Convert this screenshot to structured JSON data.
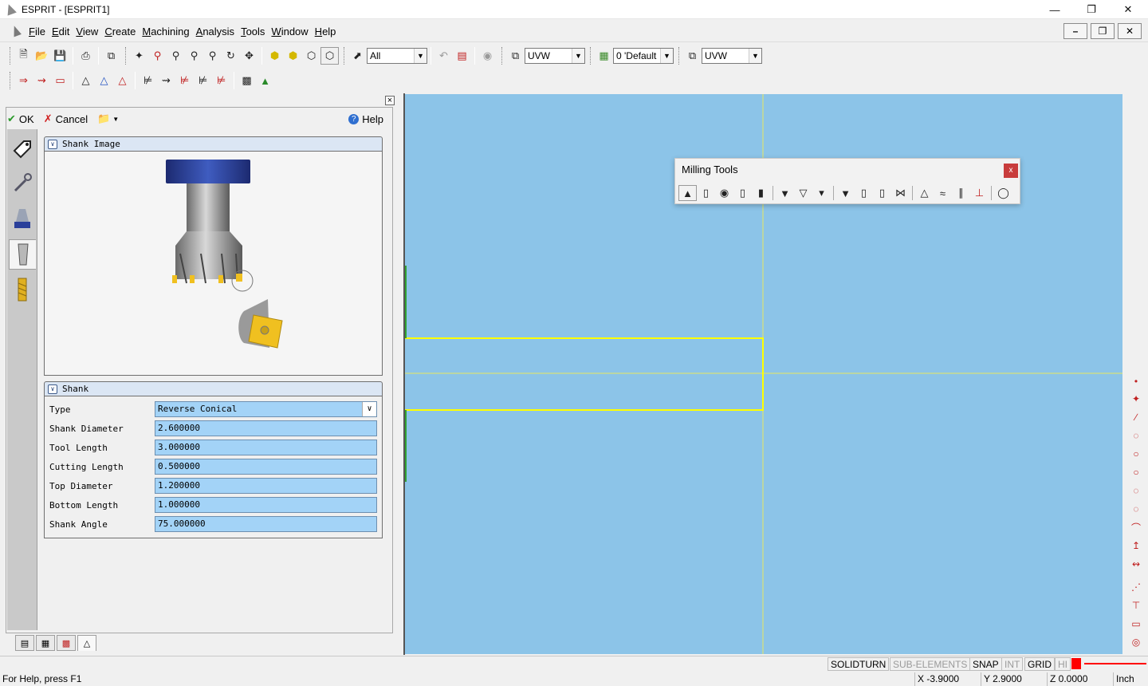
{
  "window": {
    "title": "ESPRIT - [ESPRIT1]"
  },
  "menu": {
    "items": [
      {
        "accel": "F",
        "rest": "ile"
      },
      {
        "accel": "E",
        "rest": "dit"
      },
      {
        "accel": "V",
        "rest": "iew"
      },
      {
        "accel": "C",
        "rest": "reate"
      },
      {
        "accel": "M",
        "rest": "achining"
      },
      {
        "accel": "A",
        "rest": "nalysis"
      },
      {
        "accel": "T",
        "rest": "ools"
      },
      {
        "accel": "W",
        "rest": "indow"
      },
      {
        "accel": "H",
        "rest": "elp"
      }
    ]
  },
  "toolbar": {
    "filter_value": "All",
    "uvw1": "UVW",
    "layer": "0 'Default",
    "uvw2": "UVW"
  },
  "dialog": {
    "ok_label": "OK",
    "cancel_label": "Cancel",
    "help_label": "Help",
    "shank_image_title": "Shank Image",
    "shank_title": "Shank",
    "fields": [
      {
        "label": "Type",
        "value": "Reverse Conical"
      },
      {
        "label": "Shank Diameter",
        "value": "2.600000"
      },
      {
        "label": "Tool Length",
        "value": "3.000000"
      },
      {
        "label": "Cutting Length",
        "value": "0.500000"
      },
      {
        "label": "Top Diameter",
        "value": "1.200000"
      },
      {
        "label": "Bottom Length",
        "value": "1.000000"
      },
      {
        "label": "Shank Angle",
        "value": "75.000000"
      }
    ]
  },
  "milling_tools": {
    "title": "Milling Tools",
    "close": "x"
  },
  "status": {
    "solidturn": "SOLIDTURN",
    "sub_elements": "SUB-ELEMENTS",
    "snap": "SNAP",
    "int": "INT",
    "grid": "GRID",
    "hi": "HI",
    "help_text": "For Help, press F1",
    "x": "X -3.9000",
    "y": "Y 2.9000",
    "z": "Z 0.0000",
    "unit": "Inch"
  },
  "colors": {
    "viewport": "#8cc4e8",
    "geometry": "#ffff00",
    "field_bg": "#a3d3f7",
    "shank_blue": "#2a3f9a",
    "insert_gold": "#f0c020"
  }
}
